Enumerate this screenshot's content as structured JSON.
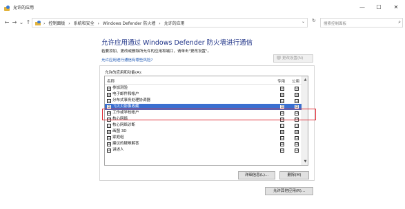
{
  "window": {
    "title": "允许的应用",
    "min": "—",
    "max": "☐",
    "close": "✕"
  },
  "nav": {
    "back": "←",
    "forward": "→",
    "up": "↑",
    "recent": "⌄",
    "crumbs": [
      "›",
      "控制面板",
      "›",
      "系统和安全",
      "›",
      "Windows Defender 防火墙",
      "›",
      "允许的应用"
    ],
    "address_dropdown": "⌄",
    "refresh": "↻",
    "search_placeholder": "搜索控制面板",
    "search_icon": "⌕"
  },
  "main": {
    "heading": "允许应用通过 Windows Defender 防火墙进行通信",
    "subtext": "若要添加、更改或删除所允许的应用和端口，请单击\"更改设置\"。",
    "risk_link": "允许应用进行通信有哪些风险?",
    "change_settings": "更改设置(N)",
    "group_title": "允许的应用和功能(A):",
    "columns": {
      "name": "名称",
      "private": "专用",
      "public": "公用"
    },
    "rows": [
      {
        "label": "参加测验",
        "checked": "☑",
        "private": "☑",
        "public": "☑"
      },
      {
        "label": "电子邮件和帐户",
        "checked": "☑",
        "private": "☑",
        "public": "☑"
      },
      {
        "label": "分布式事务处理协调器",
        "checked": "☐",
        "private": "☐",
        "public": "☐"
      },
      {
        "label": "飞贝贝影像收藏",
        "checked": "☑",
        "private": "☑",
        "public": "☑"
      },
      {
        "label": "工作或学校帐户",
        "checked": "☑",
        "private": "☑",
        "public": "☑"
      },
      {
        "label": "核心网络",
        "checked": "☑",
        "private": "☑",
        "public": "☑"
      },
      {
        "label": "核心网络诊断",
        "checked": "☐",
        "private": "☐",
        "public": "☐"
      },
      {
        "label": "画图 3D",
        "checked": "☑",
        "private": "☑",
        "public": "☑"
      },
      {
        "label": "家庭组",
        "checked": "☐",
        "private": "☐",
        "public": "☐"
      },
      {
        "label": "建议的疑难解答",
        "checked": "☑",
        "private": "☑",
        "public": "☑"
      },
      {
        "label": "讲述人",
        "checked": "☑",
        "private": "☑",
        "public": "☑"
      }
    ],
    "details_button": "详细信息(L)...",
    "delete_button": "删除(M)",
    "allow_other_button": "允许其他应用(R)...",
    "scroll_up": "▲",
    "scroll_down": "▼"
  },
  "colors": {
    "selected_row": "#3a6fd0",
    "highlight_box": "#e0303a",
    "heading": "#1e3287",
    "link": "#1a56b5"
  }
}
